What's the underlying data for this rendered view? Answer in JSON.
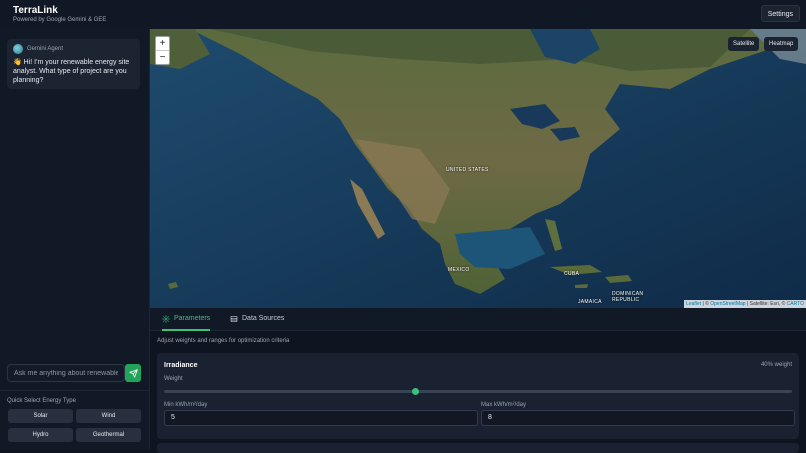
{
  "header": {
    "title": "TerraLink",
    "subtitle": "Powered by Google Gemini & GEE",
    "settings_label": "Settings"
  },
  "chat": {
    "agent_name": "Gemini Agent",
    "agent_avatar_icon": "globe-icon",
    "message_emoji": "👋",
    "message": "Hi! I'm your renewable energy site analyst. What type of project are you planning?",
    "input_placeholder": "Ask me anything about renewable energy",
    "send_icon": "send-icon"
  },
  "quick_select": {
    "label": "Quick Select Energy Type",
    "options": [
      "Solar",
      "Wind",
      "Hydro",
      "Geothermal"
    ]
  },
  "map": {
    "zoom_in": "+",
    "zoom_out": "−",
    "layers": [
      "Satellite",
      "Heatmap"
    ],
    "labels": [
      "UNITED STATES",
      "MEXICO",
      "CUBA",
      "JAMAICA",
      "DOMINICAN REPUBLIC"
    ],
    "attribution": {
      "leaflet": "Leaflet",
      "sep1": " | © ",
      "osm": "OpenStreetMap",
      "sep2": " | Satellite: Esri, © ",
      "carto": "CARTO"
    }
  },
  "tabs": [
    {
      "label": "Parameters",
      "icon": "gear-icon",
      "active": true
    },
    {
      "label": "Data Sources",
      "icon": "database-icon",
      "active": false
    }
  ],
  "parameters": {
    "description": "Adjust weights and ranges for optimization criteria",
    "criteria": [
      {
        "name": "Irradiance",
        "weight_text": "40% weight",
        "weight_label": "Weight",
        "weight_value": 0.4,
        "min_label": "Min kWh/m²/day",
        "min_value": "5",
        "max_label": "Max kWh/m²/day",
        "max_value": "8"
      }
    ]
  },
  "colors": {
    "accent": "#3ac17a",
    "send_button": "#22a35a",
    "background": "#0f1520"
  }
}
